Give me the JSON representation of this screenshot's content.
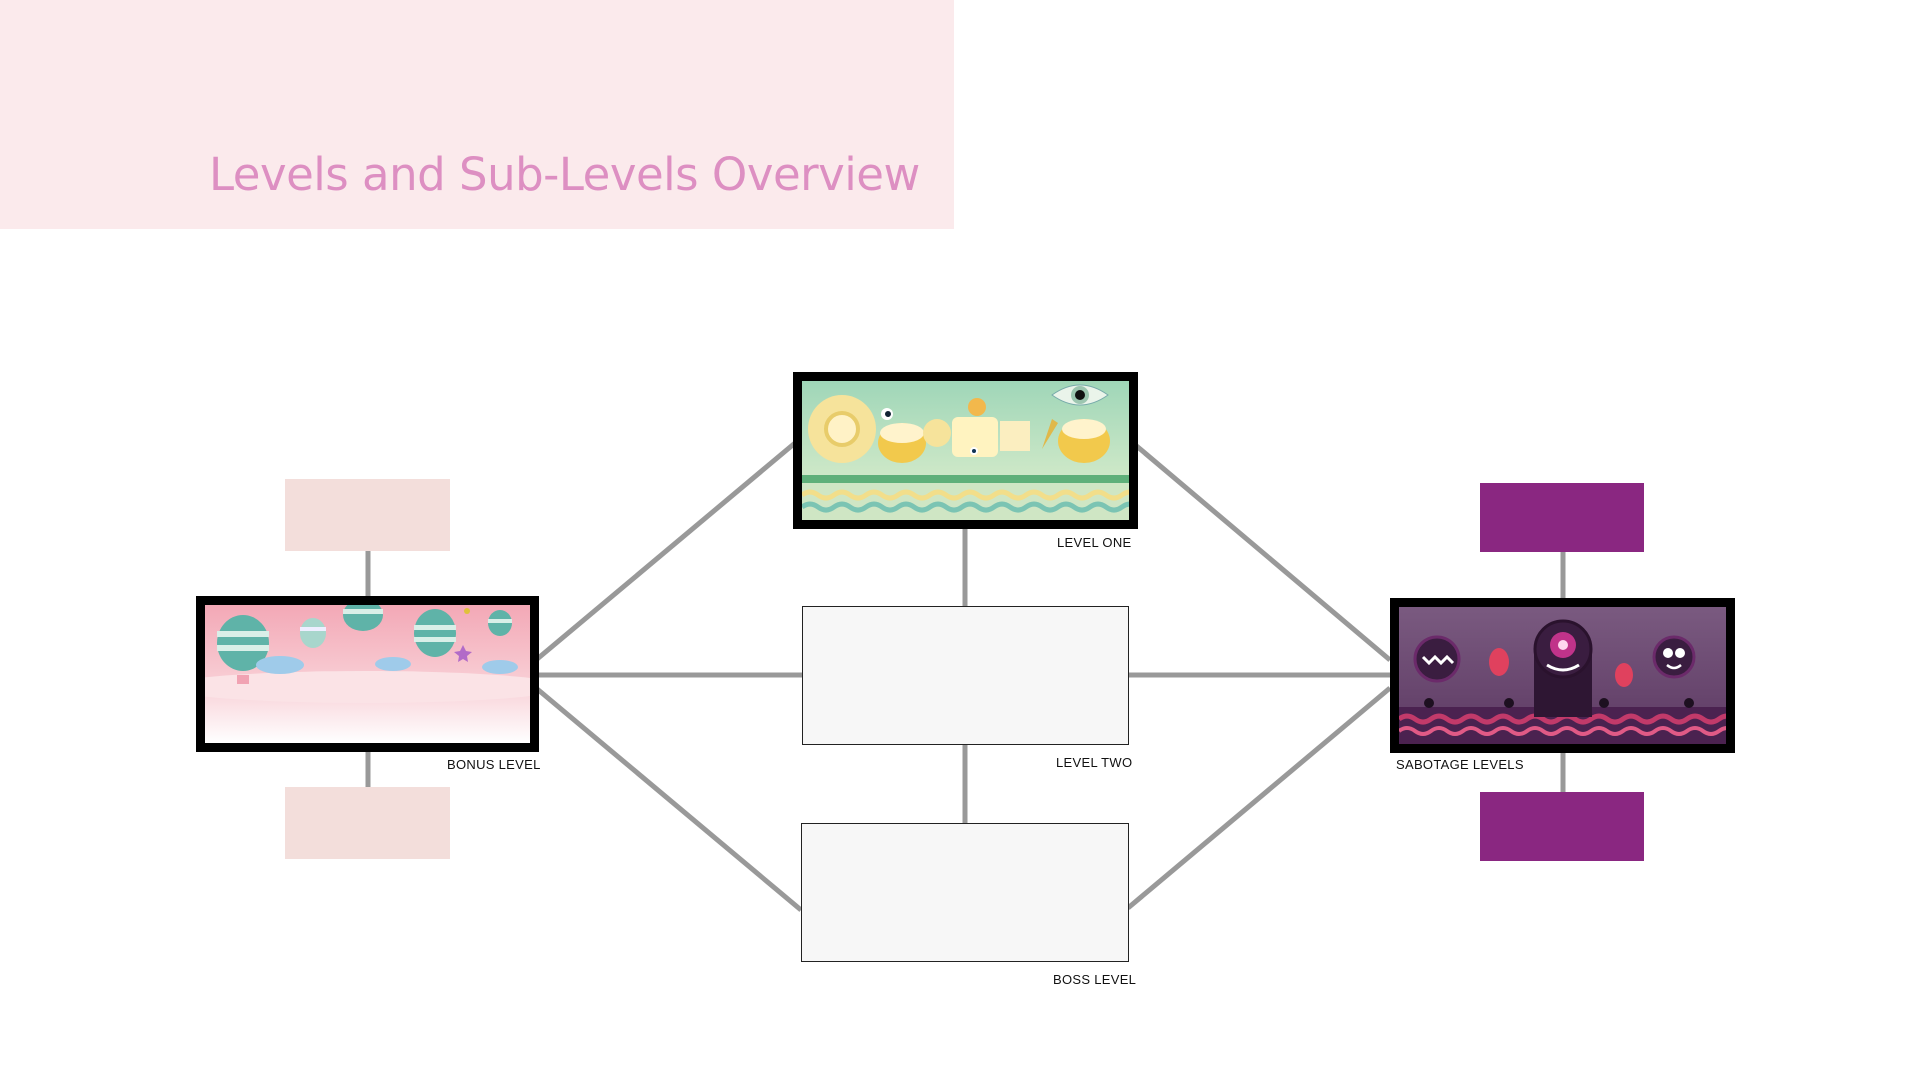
{
  "title": "Levels and Sub-Levels Overview",
  "nodes": {
    "level_one": {
      "caption": "LEVEL ONE"
    },
    "level_two": {
      "caption": "LEVEL TWO"
    },
    "boss_level": {
      "caption": "BOSS LEVEL"
    },
    "bonus_level": {
      "caption": "BONUS LEVEL"
    },
    "sabotage_levels": {
      "caption": "SABOTAGE LEVELS"
    }
  },
  "colors": {
    "title": "#dd8fc2",
    "title_band": "#fbeaec",
    "connector": "#999999",
    "bonus_sub_level": "#f3dedb",
    "sabotage_sub_level": "#8a2781"
  }
}
